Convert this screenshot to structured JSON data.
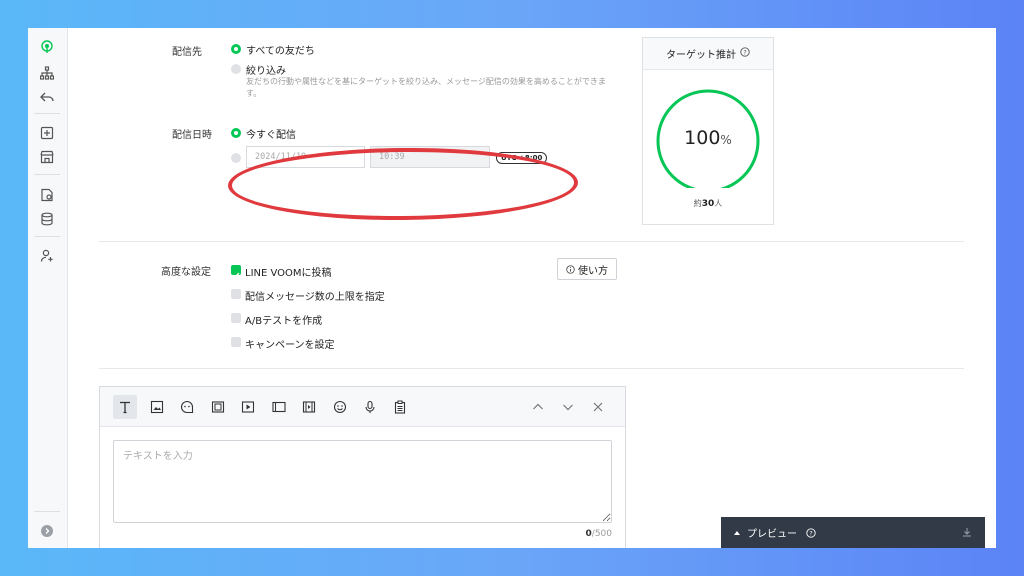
{
  "delivery": {
    "label": "配信先",
    "option_all": "すべての友だち",
    "option_filter": "絞り込み",
    "filter_note_line1": "友だちの行動や属性などを基にターゲットを絞り込み、メッセージ配信の効果を高めることができま",
    "filter_note_line2": "す。"
  },
  "schedule": {
    "label": "配信日時",
    "option_now": "今すぐ配信",
    "date_placeholder": "2024/11/19",
    "time_placeholder": "10:39",
    "timezone": "UTC +8:00"
  },
  "target": {
    "title": "ターゲット推計",
    "percent_value": "100",
    "percent_sign": "%",
    "approx": "約",
    "count": "30",
    "unit": "人",
    "gauge_fraction": 1.0
  },
  "advanced": {
    "label": "高度な設定",
    "options": [
      {
        "label": "LINE VOOMに投稿",
        "checked": true
      },
      {
        "label": "配信メッセージ数の上限を指定",
        "checked": false
      },
      {
        "label": "A/Bテストを作成",
        "checked": false
      },
      {
        "label": "キャンペーンを設定",
        "checked": false
      }
    ],
    "help_label": "使い方"
  },
  "editor": {
    "placeholder": "テキストを入力",
    "count_current": "0",
    "count_max": "/500"
  },
  "preview": {
    "label": "プレビュー"
  },
  "colors": {
    "accent": "#06c755",
    "highlight": "#e0393e",
    "preview_bar": "#313a46"
  }
}
